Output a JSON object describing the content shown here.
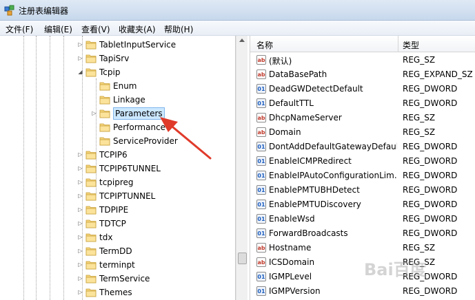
{
  "window": {
    "title": "注册表编辑器",
    "app_icon": "regedit-icon"
  },
  "menu": [
    "文件(F)",
    "编辑(E)",
    "查看(V)",
    "收藏夹(A)",
    "帮助(H)"
  ],
  "tree": [
    {
      "label": "TabletInputService",
      "expander": "▷"
    },
    {
      "label": "TapiSrv",
      "expander": "▷"
    },
    {
      "label": "Tcpip",
      "expander": "◢"
    },
    {
      "label": "Enum",
      "expander": ""
    },
    {
      "label": "Linkage",
      "expander": ""
    },
    {
      "label": "Parameters",
      "expander": "▷",
      "selected": true
    },
    {
      "label": "Performance",
      "expander": ""
    },
    {
      "label": "ServiceProvider",
      "expander": ""
    },
    {
      "label": "TCPIP6",
      "expander": "▷"
    },
    {
      "label": "TCPIP6TUNNEL",
      "expander": "▷"
    },
    {
      "label": "tcpipreg",
      "expander": "▷"
    },
    {
      "label": "TCPIPTUNNEL",
      "expander": "▷"
    },
    {
      "label": "TDPIPE",
      "expander": "▷"
    },
    {
      "label": "TDTCP",
      "expander": "▷"
    },
    {
      "label": "tdx",
      "expander": "▷"
    },
    {
      "label": "TermDD",
      "expander": "▷"
    },
    {
      "label": "terminpt",
      "expander": "▷"
    },
    {
      "label": "TermService",
      "expander": "▷"
    },
    {
      "label": "Themes",
      "expander": "▷"
    }
  ],
  "list": {
    "columns": {
      "name": "名称",
      "type": "类型"
    },
    "rows": [
      {
        "icon": "ab",
        "name": "(默认)",
        "type": "REG_SZ"
      },
      {
        "icon": "ab",
        "name": "DataBasePath",
        "type": "REG_EXPAND_SZ"
      },
      {
        "icon": "01",
        "name": "DeadGWDetectDefault",
        "type": "REG_DWORD"
      },
      {
        "icon": "01",
        "name": "DefaultTTL",
        "type": "REG_DWORD"
      },
      {
        "icon": "ab",
        "name": "DhcpNameServer",
        "type": "REG_SZ"
      },
      {
        "icon": "ab",
        "name": "Domain",
        "type": "REG_SZ"
      },
      {
        "icon": "01",
        "name": "DontAddDefaultGatewayDefault",
        "type": "REG_DWORD"
      },
      {
        "icon": "01",
        "name": "EnableICMPRedirect",
        "type": "REG_DWORD"
      },
      {
        "icon": "01",
        "name": "EnableIPAutoConfigurationLim...",
        "type": "REG_DWORD"
      },
      {
        "icon": "01",
        "name": "EnablePMTUBHDetect",
        "type": "REG_DWORD"
      },
      {
        "icon": "01",
        "name": "EnablePMTUDiscovery",
        "type": "REG_DWORD"
      },
      {
        "icon": "01",
        "name": "EnableWsd",
        "type": "REG_DWORD"
      },
      {
        "icon": "01",
        "name": "ForwardBroadcasts",
        "type": "REG_DWORD"
      },
      {
        "icon": "ab",
        "name": "Hostname",
        "type": "REG_SZ"
      },
      {
        "icon": "ab",
        "name": "ICSDomain",
        "type": "REG_SZ"
      },
      {
        "icon": "01",
        "name": "IGMPLevel",
        "type": "REG_DWORD"
      },
      {
        "icon": "01",
        "name": "IGMPVersion",
        "type": "REG_DWORD"
      }
    ]
  },
  "annotation": {
    "color": "#e03a2a",
    "target": "Parameters"
  },
  "watermark": "Bai百度"
}
